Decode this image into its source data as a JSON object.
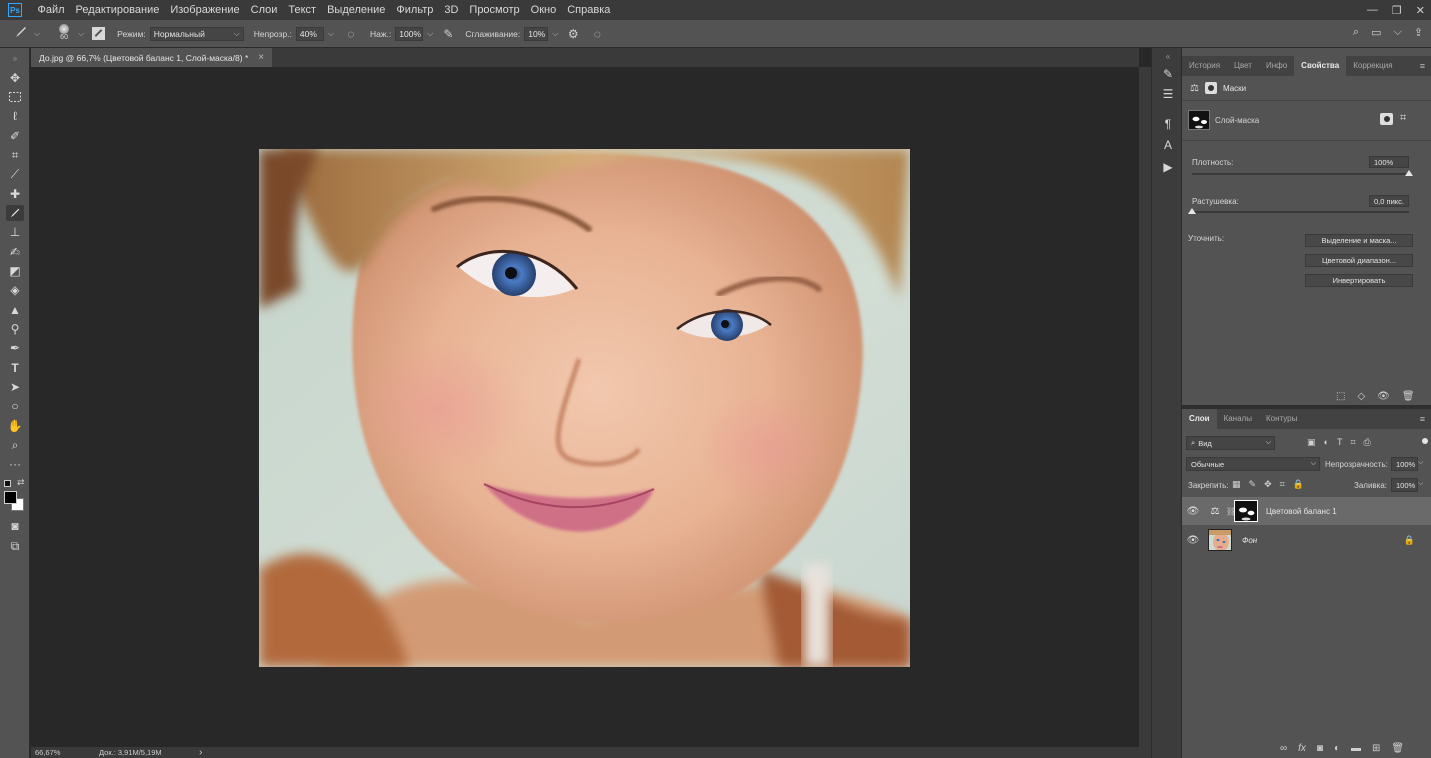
{
  "app": {
    "logo": "Ps"
  },
  "menu": [
    "Файл",
    "Редактирование",
    "Изображение",
    "Слои",
    "Текст",
    "Выделение",
    "Фильтр",
    "3D",
    "Просмотр",
    "Окно",
    "Справка"
  ],
  "options": {
    "brush_size": "60",
    "mode_label": "Режим:",
    "mode_value": "Нормальный",
    "opacity_label": "Непрозр.:",
    "opacity_value": "40%",
    "flow_label": "Наж.:",
    "flow_value": "100%",
    "smoothing_label": "Сглаживание:",
    "smoothing_value": "10%"
  },
  "document": {
    "tab_title": "До.jpg @ 66,7% (Цветовой баланс 1, Слой-маска/8) *",
    "close": "×"
  },
  "status": {
    "zoom": "66,67%",
    "doc_size": "Док.: 3,91M/5,19M",
    "arrow": "›"
  },
  "properties_panel": {
    "tabs": [
      "История",
      "Цвет",
      "Инфо",
      "Свойства",
      "Коррекция"
    ],
    "active_tab": "Свойства",
    "header": "Маски",
    "mask_type": "Слой-маска",
    "density_label": "Плотность:",
    "density_value": "100%",
    "density_level": 1.0,
    "feather_label": "Растушевка:",
    "feather_value": "0,0 пикс.",
    "feather_level": 0.0,
    "refine_label": "Уточнить:",
    "buttons": [
      "Выделение и маска...",
      "Цветовой диапазон...",
      "Инвертировать"
    ]
  },
  "layers_panel": {
    "tabs": [
      "Слои",
      "Каналы",
      "Контуры"
    ],
    "active_tab": "Слои",
    "filter_value": "Вид",
    "blend_mode": "Обычные",
    "opacity_label": "Непрозрачность:",
    "opacity_value": "100%",
    "lock_label": "Закрепить:",
    "fill_label": "Заливка:",
    "fill_value": "100%",
    "layers": [
      {
        "name": "Цветовой баланс 1",
        "selected": true
      },
      {
        "name": "Фон",
        "selected": false
      }
    ]
  },
  "colors": {
    "accent": "#31a8ff",
    "panel": "#535353",
    "canvas_bg": "#282828"
  }
}
